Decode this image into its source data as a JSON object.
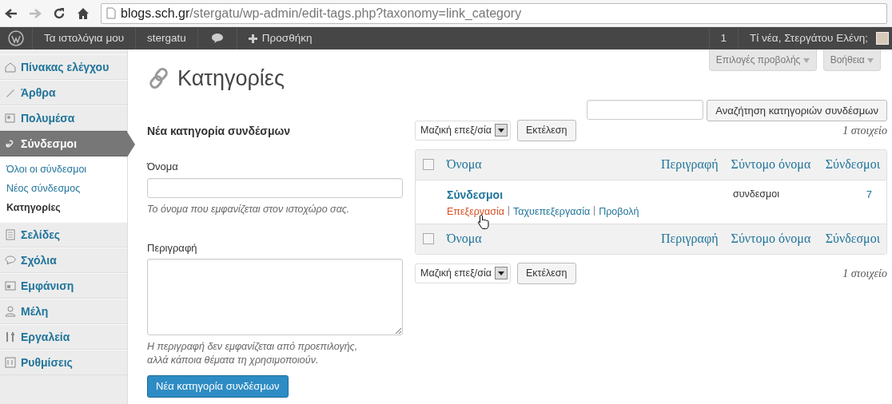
{
  "browser": {
    "url_host": "blogs.sch.gr",
    "url_path": "/stergatu/wp-admin/edit-tags.php?taxonomy=link_category"
  },
  "admin_bar": {
    "items": [
      {
        "kind": "logo"
      },
      {
        "kind": "text",
        "label": "Τα ιστολόγια μου"
      },
      {
        "kind": "text",
        "label": "stergatu"
      },
      {
        "kind": "comments"
      },
      {
        "kind": "add",
        "label": "Προσθήκη"
      }
    ],
    "updates": "1",
    "greeting": "Τί νέα, Στεργάτου Ελένη;"
  },
  "sidebar": {
    "items": [
      {
        "label": "Πίνακας ελέγχου",
        "selected": false
      },
      {
        "label": "Άρθρα",
        "selected": false
      },
      {
        "label": "Πολυμέσα",
        "selected": false
      },
      {
        "label": "Σύνδεσμοι",
        "selected": true,
        "children": [
          {
            "label": "Όλοι οι σύνδεσμοι",
            "selected": false
          },
          {
            "label": "Νέος σύνδεσμος",
            "selected": false
          },
          {
            "label": "Κατηγορίες",
            "selected": true
          }
        ]
      },
      {
        "label": "Σελίδες",
        "selected": false
      },
      {
        "label": "Σχόλια",
        "selected": false
      },
      {
        "label": "Εμφάνιση",
        "selected": false
      },
      {
        "label": "Μέλη",
        "selected": false
      },
      {
        "label": "Εργαλεία",
        "selected": false
      },
      {
        "label": "Ρυθμίσεις",
        "selected": false
      }
    ]
  },
  "screen_tabs": [
    "Επιλογές προβολής",
    "Βοήθεια"
  ],
  "title": "Κατηγορίες",
  "search_button": "Αναζήτηση κατηγοριών συνδέσμων",
  "form": {
    "heading": "Νέα κατηγορία συνδέσμων",
    "fields": [
      {
        "kind": "input",
        "label": "Όνομα",
        "hint": "Το όνομα που εμφανίζεται στον ιστοχώρο σας."
      },
      {
        "kind": "textarea",
        "label": "Περιγραφή",
        "hint": "Η περιγραφή δεν εμφανίζεται από προεπιλογής, αλλά κάποια θέματα τη χρησιμοποιούν."
      }
    ],
    "submit": "Νέα κατηγορία συνδέσμων"
  },
  "bulk_top": {
    "select": "Μαζική επεξ/σία",
    "apply": "Εκτέλεση",
    "count": "1 στοιχείο"
  },
  "table": {
    "header": {
      "checked": false,
      "columns": [
        "Όνομα",
        "Περιγραφή",
        "Σύντομο όνομα",
        "Σύνδεσμοι"
      ]
    },
    "rows": [
      {
        "name": "Σύνδεσμοι",
        "actions": [
          {
            "label": "Επεξεργασία",
            "hovered": true
          },
          {
            "label": "Ταχυεπεξεργασία",
            "hovered": false
          },
          {
            "label": "Προβολή",
            "hovered": false
          }
        ],
        "slug": "συνδεσμοι",
        "count": "7"
      }
    ],
    "footer": {
      "checked": false,
      "columns": [
        "Όνομα",
        "Περιγραφή",
        "Σύντομο όνομα",
        "Σύνδεσμοι"
      ]
    }
  },
  "bulk_bottom": {
    "select": "Μαζική επεξ/σία",
    "apply": "Εκτέλεση",
    "count": "1 στοιχείο"
  }
}
